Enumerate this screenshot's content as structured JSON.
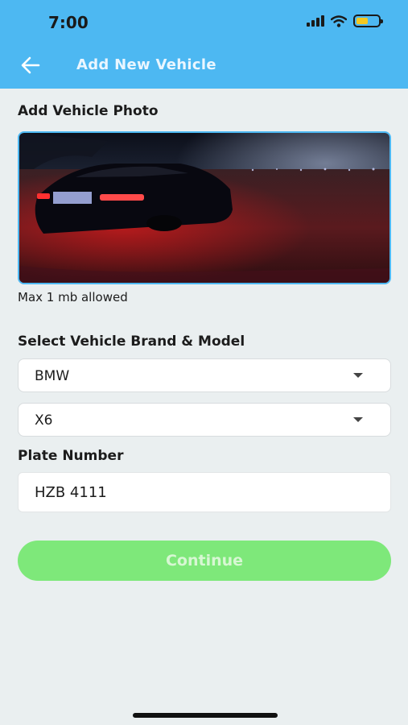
{
  "status_bar": {
    "time": "7:00"
  },
  "header": {
    "title": "Add New Vehicle",
    "back_icon": "arrow-left-icon"
  },
  "photo": {
    "label": "Add Vehicle Photo",
    "hint": "Max 1 mb allowed"
  },
  "vehicle": {
    "label": "Select Vehicle Brand & Model",
    "brand": "BMW",
    "model": "X6"
  },
  "plate": {
    "label": "Plate Number",
    "value": "HZB 4111"
  },
  "actions": {
    "continue_label": "Continue"
  },
  "colors": {
    "header": "#4db8f2",
    "background": "#eaeff0",
    "continue_button": "#7ee87a"
  }
}
